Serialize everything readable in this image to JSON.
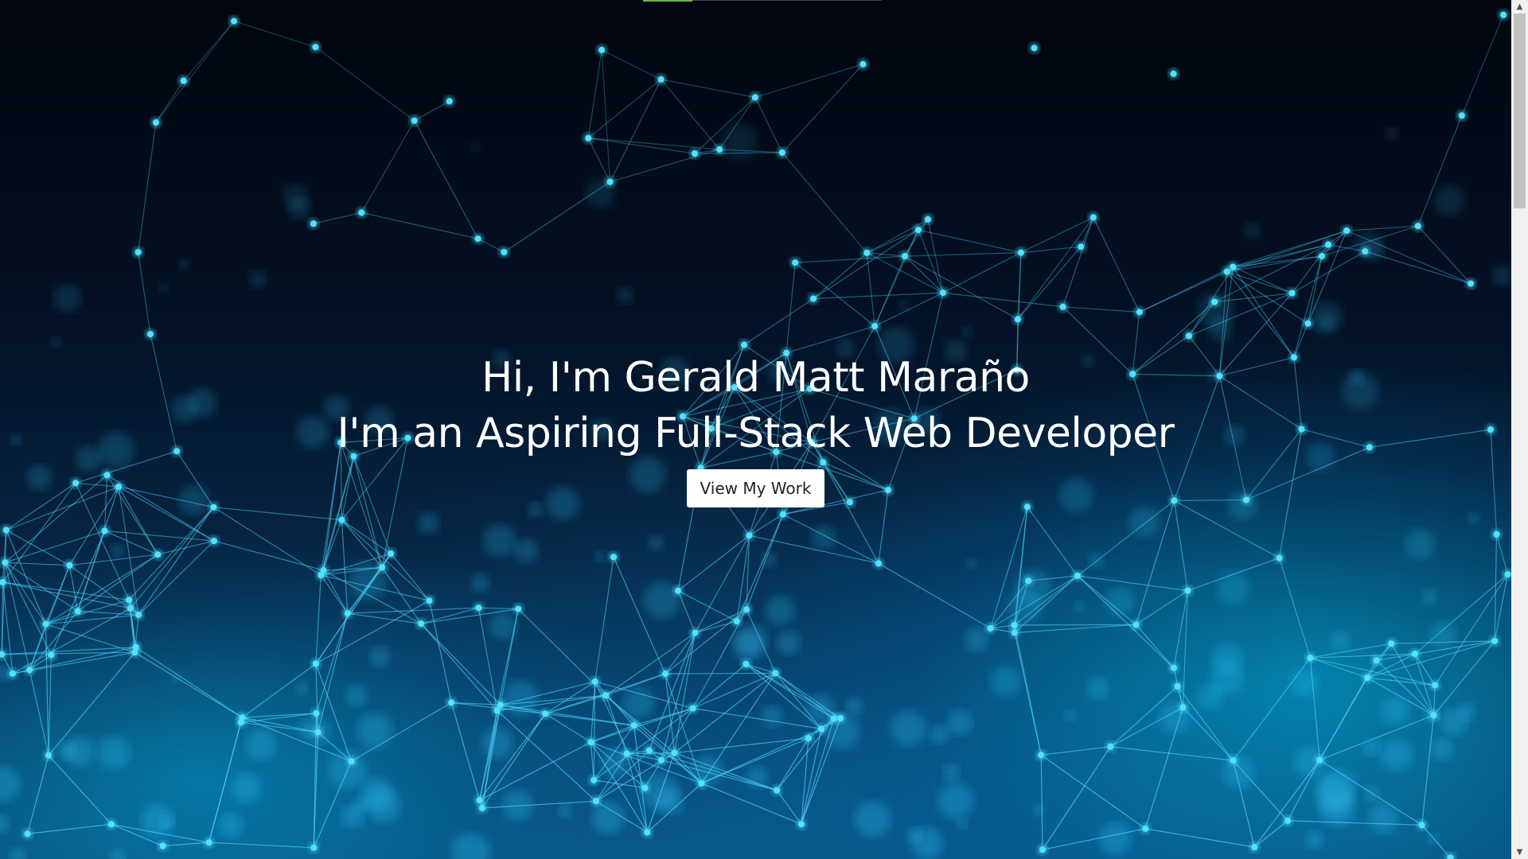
{
  "hero": {
    "line1": "Hi, I'm Gerald Matt Maraño",
    "line2": "I'm an Aspiring Full-Stack Web Developer",
    "cta_label": "View My Work"
  },
  "scrollbar": {
    "up_icon": "chevron-up-icon",
    "down_icon": "chevron-down-icon",
    "up_glyph": "▲",
    "down_glyph": "▼"
  },
  "colors": {
    "background_dark": "#020814",
    "network_cyan": "#4fe3ff",
    "nav_active": "#5fbd3c",
    "button_bg": "#ffffff",
    "heading_text": "#ffffff"
  }
}
